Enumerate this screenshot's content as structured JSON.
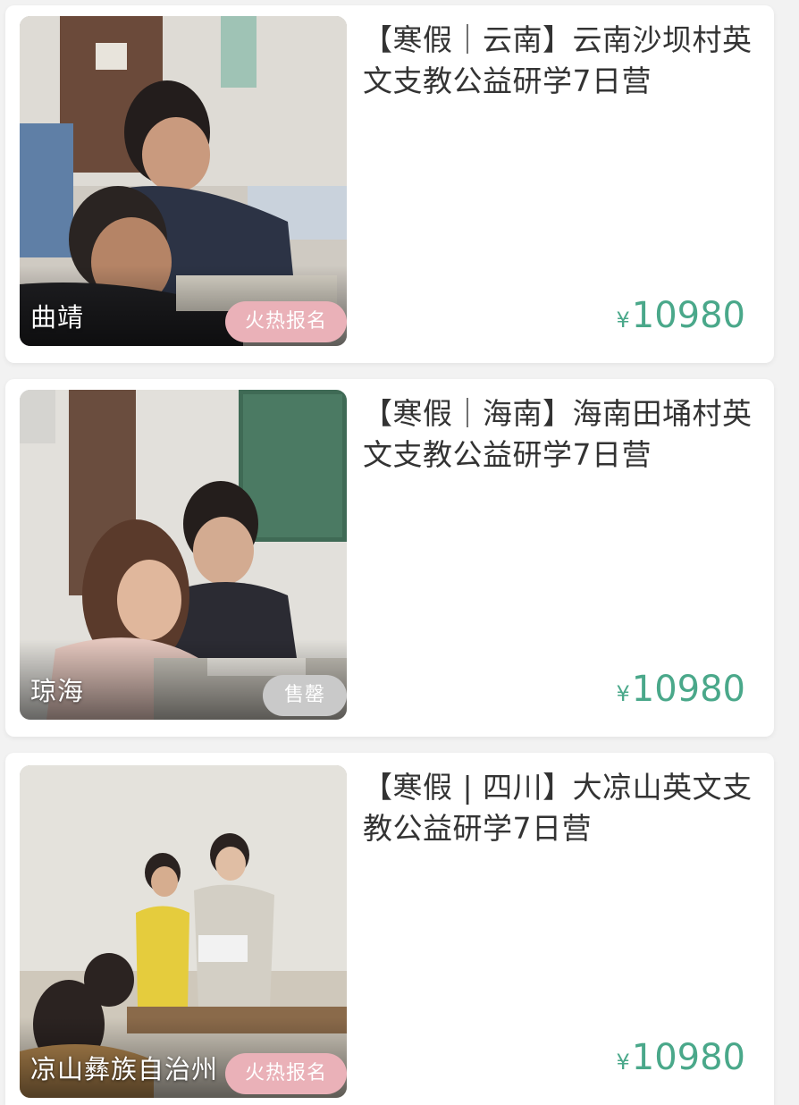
{
  "colors": {
    "price": "#4aa88a",
    "hot_badge": "#eab1b8",
    "sold_badge": "#c9c9c9",
    "card_bg": "#ffffff",
    "page_bg": "#f2f2f2"
  },
  "currency_symbol": "¥",
  "items": [
    {
      "title": "【寒假｜云南】云南沙坝村英文支教公益研学7日营",
      "location": "曲靖",
      "badge": "火热报名",
      "status": "hot",
      "price": "10980"
    },
    {
      "title": "【寒假｜海南】海南田埇村英文支教公益研学7日营",
      "location": "琼海",
      "badge": "售罄",
      "status": "sold-out",
      "price": "10980"
    },
    {
      "title": "【寒假 | 四川】大凉山英文支教公益研学7日营",
      "location": "凉山彝族自治州",
      "badge": "火热报名",
      "status": "hot",
      "price": "10980"
    }
  ]
}
